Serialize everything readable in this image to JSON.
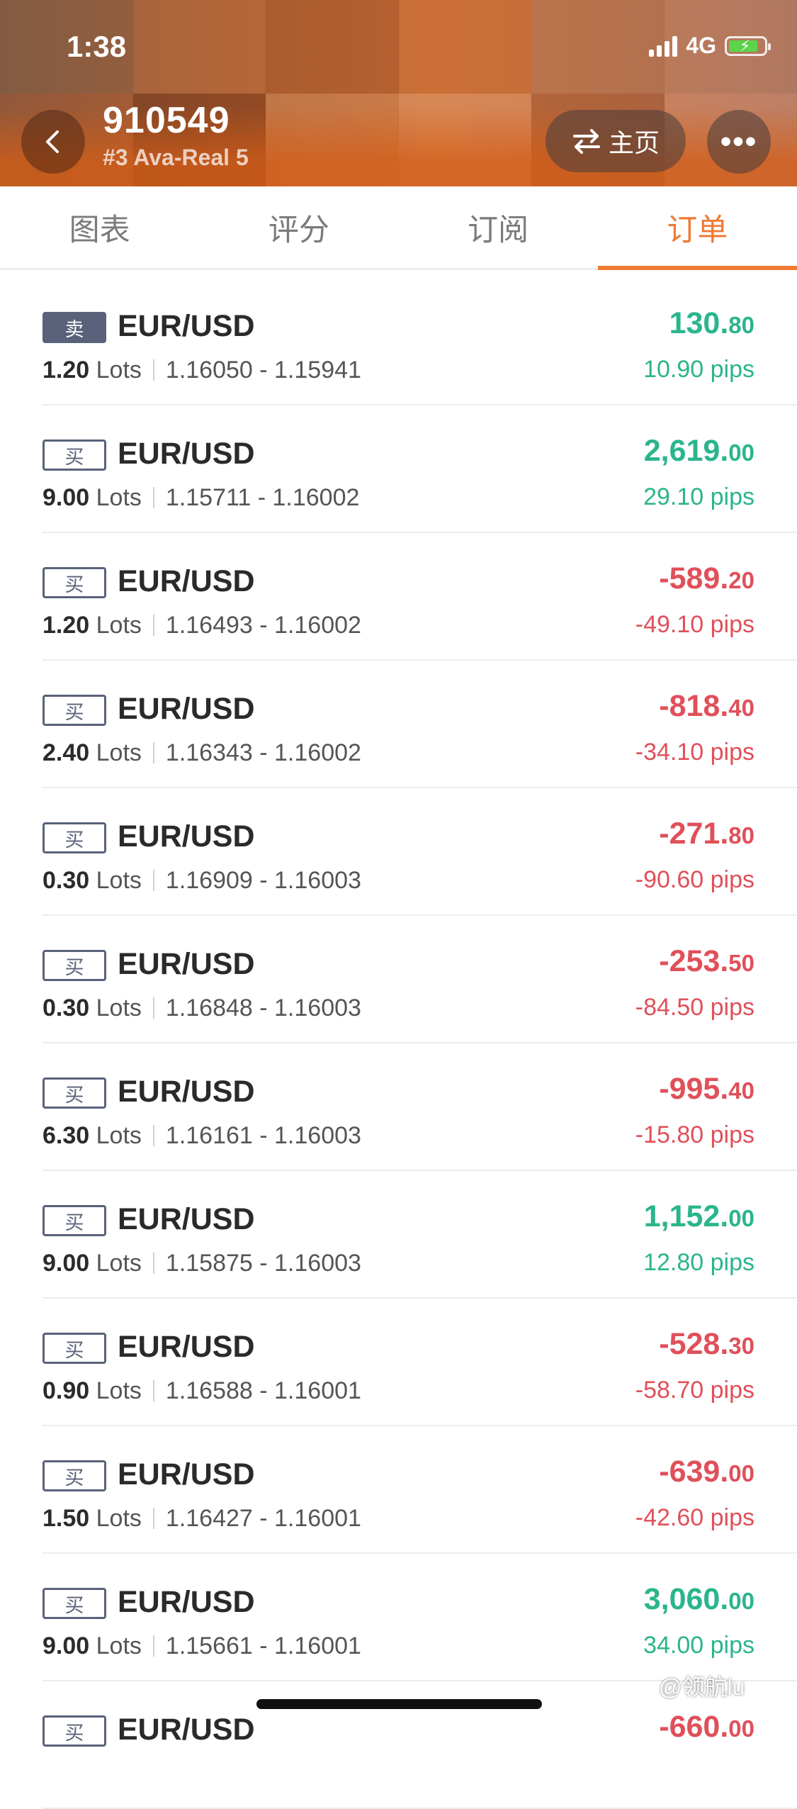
{
  "status_bar": {
    "time": "1:38",
    "network": "4G"
  },
  "header": {
    "account_id": "910549",
    "account_sub": "#3 Ava-Real 5",
    "home_label": "主页",
    "more_label": "•••"
  },
  "tabs": [
    {
      "label": "图表",
      "active": false
    },
    {
      "label": "评分",
      "active": false
    },
    {
      "label": "订阅",
      "active": false
    },
    {
      "label": "订单",
      "active": true
    }
  ],
  "orders": [
    {
      "side": "卖",
      "pair": "EUR/USD",
      "lots": "1.20",
      "lots_unit": "Lots",
      "range": "1.16050 - 1.15941",
      "profit_main": "130.",
      "profit_cents": "80",
      "pips": "10.90 pips",
      "positive": true
    },
    {
      "side": "买",
      "pair": "EUR/USD",
      "lots": "9.00",
      "lots_unit": "Lots",
      "range": "1.15711 - 1.16002",
      "profit_main": "2,619.",
      "profit_cents": "00",
      "pips": "29.10 pips",
      "positive": true
    },
    {
      "side": "买",
      "pair": "EUR/USD",
      "lots": "1.20",
      "lots_unit": "Lots",
      "range": "1.16493 - 1.16002",
      "profit_main": "-589.",
      "profit_cents": "20",
      "pips": "-49.10 pips",
      "positive": false
    },
    {
      "side": "买",
      "pair": "EUR/USD",
      "lots": "2.40",
      "lots_unit": "Lots",
      "range": "1.16343 - 1.16002",
      "profit_main": "-818.",
      "profit_cents": "40",
      "pips": "-34.10 pips",
      "positive": false
    },
    {
      "side": "买",
      "pair": "EUR/USD",
      "lots": "0.30",
      "lots_unit": "Lots",
      "range": "1.16909 - 1.16003",
      "profit_main": "-271.",
      "profit_cents": "80",
      "pips": "-90.60 pips",
      "positive": false
    },
    {
      "side": "买",
      "pair": "EUR/USD",
      "lots": "0.30",
      "lots_unit": "Lots",
      "range": "1.16848 - 1.16003",
      "profit_main": "-253.",
      "profit_cents": "50",
      "pips": "-84.50 pips",
      "positive": false
    },
    {
      "side": "买",
      "pair": "EUR/USD",
      "lots": "6.30",
      "lots_unit": "Lots",
      "range": "1.16161 - 1.16003",
      "profit_main": "-995.",
      "profit_cents": "40",
      "pips": "-15.80 pips",
      "positive": false
    },
    {
      "side": "买",
      "pair": "EUR/USD",
      "lots": "9.00",
      "lots_unit": "Lots",
      "range": "1.15875 - 1.16003",
      "profit_main": "1,152.",
      "profit_cents": "00",
      "pips": "12.80 pips",
      "positive": true
    },
    {
      "side": "买",
      "pair": "EUR/USD",
      "lots": "0.90",
      "lots_unit": "Lots",
      "range": "1.16588 - 1.16001",
      "profit_main": "-528.",
      "profit_cents": "30",
      "pips": "-58.70 pips",
      "positive": false
    },
    {
      "side": "买",
      "pair": "EUR/USD",
      "lots": "1.50",
      "lots_unit": "Lots",
      "range": "1.16427 - 1.16001",
      "profit_main": "-639.",
      "profit_cents": "00",
      "pips": "-42.60 pips",
      "positive": false
    },
    {
      "side": "买",
      "pair": "EUR/USD",
      "lots": "9.00",
      "lots_unit": "Lots",
      "range": "1.15661 - 1.16001",
      "profit_main": "3,060.",
      "profit_cents": "00",
      "pips": "34.00 pips",
      "positive": true
    },
    {
      "side": "买",
      "pair": "EUR/USD",
      "lots": "",
      "lots_unit": "",
      "range": "",
      "profit_main": "-660.",
      "profit_cents": "00",
      "pips": "",
      "positive": false
    }
  ],
  "watermark": "@领航lu",
  "colors": {
    "accent": "#ef7a33",
    "positive": "#2bb58c",
    "negative": "#e0505a",
    "badge": "#59627a"
  }
}
